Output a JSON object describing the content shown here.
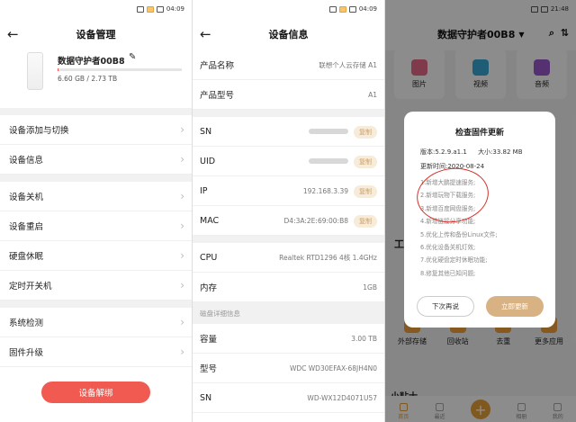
{
  "status_bar": {
    "time_left": "04:09",
    "time_mid": "04:09",
    "time_right": "21:48"
  },
  "panel1": {
    "title": "设备管理",
    "device": {
      "name": "数据守护者00B8",
      "storage": "6.60 GB / 2.73 TB",
      "usage_fraction": 0.002
    },
    "rows": [
      "设备添加与切换",
      "设备信息",
      "设备关机",
      "设备重启",
      "硬盘休眠",
      "定时开关机",
      "系统检测",
      "固件升级"
    ],
    "unbind_label": "设备解绑"
  },
  "panel2": {
    "title": "设备信息",
    "product_name": {
      "label": "产品名称",
      "value": "联想个人云存储 A1"
    },
    "product_model": {
      "label": "产品型号",
      "value": "A1"
    },
    "sn": {
      "label": "SN",
      "copy": "复制"
    },
    "uid": {
      "label": "UID",
      "copy": "复制"
    },
    "ip": {
      "label": "IP",
      "value": "192.168.3.39",
      "copy": "复制"
    },
    "mac": {
      "label": "MAC",
      "value": "D4:3A:2E:69:00:B8",
      "copy": "复制"
    },
    "cpu": {
      "label": "CPU",
      "value": "Realtek RTD1296 4核 1.4GHz"
    },
    "memory": {
      "label": "内存",
      "value": "1GB"
    },
    "disk_section": "磁盘详细信息",
    "capacity": {
      "label": "容量",
      "value": "3.00 TB"
    },
    "disk_model": {
      "label": "型号",
      "value": "WDC WD30EFAX-68JH4N0"
    },
    "disk_sn": {
      "label": "SN",
      "value": "WD-WX12D4071U57"
    }
  },
  "panel3": {
    "title": "数据守护者00B8",
    "tiles": [
      "图片",
      "视频",
      "音频"
    ],
    "tools_label": "工",
    "bottom_tiles": [
      "外部存储",
      "回收站",
      "去重",
      "更多应用"
    ],
    "tips_label": "小贴士",
    "tabs": [
      "首页",
      "最近",
      "",
      "相册",
      "我的"
    ],
    "dialog": {
      "title": "检查固件更新",
      "version": "版本:5.2.9.a1.1",
      "size": "大小:33.82 MB",
      "date": "更新时间:2020-08-24",
      "notes": [
        "1.新增大鹏提速服务;",
        "2.新增玩物下载服务;",
        "3.新增百度网盘服务;",
        "4.新增链接分享功能;",
        "5.优化上传和备份Linux文件;",
        "6.优化设备关机灯效;",
        "7.优化硬盘定时休眠功能;",
        "8.修复其他已知问题;"
      ],
      "later": "下次再说",
      "update": "立即更新"
    }
  }
}
